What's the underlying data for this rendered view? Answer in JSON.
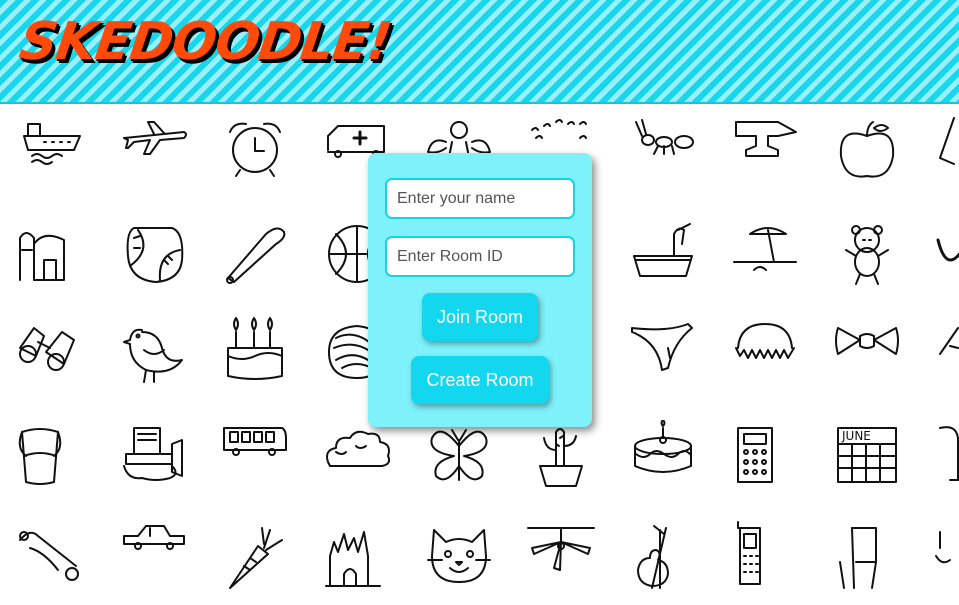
{
  "header": {
    "logo": "SKEDOODLE!",
    "colors": {
      "stripe_dark": "#19d6ea",
      "stripe_light": "#9af0fa",
      "logo": "#ff4a0a"
    }
  },
  "background_doodles": {
    "rows": [
      [
        "boat-icon",
        "airplane-icon",
        "alarm-clock-icon",
        "ambulance-icon",
        "angel-icon",
        "animal-migration-icon",
        "ant-icon",
        "anvil-icon",
        "apple-icon",
        "arm-icon"
      ],
      [
        "barn-icon",
        "baseball-icon",
        "baseball-bat-icon",
        "basketball-icon",
        "bat-icon",
        "bathtub-icon",
        "beach-icon",
        "bear-icon",
        "beard-icon"
      ],
      [
        "binoculars-icon",
        "bird-icon",
        "birthday-cake-icon",
        "blackberry-icon",
        "blueberry-icon",
        "book-icon",
        "boomerang-icon",
        "bottlecap-icon",
        "bowtie-icon",
        "bracelet-icon"
      ],
      [
        "bucket-icon",
        "bulldozer-icon",
        "bus-icon",
        "bush-icon",
        "butterfly-icon",
        "cactus-icon",
        "cake-icon",
        "calculator-icon",
        "calendar-icon",
        "camel-icon"
      ],
      [
        "canoe-icon",
        "car-icon",
        "carrot-icon",
        "castle-icon",
        "cat-icon",
        "ceiling-fan-icon",
        "cello-icon",
        "cell-phone-icon",
        "chair-icon",
        "chandelier-icon"
      ]
    ],
    "calendar_text": "JUNE"
  },
  "room_panel": {
    "name_placeholder": "Enter your name",
    "room_placeholder": "Enter Room ID",
    "join_label": "Join Room",
    "create_label": "Create Room",
    "colors": {
      "panel": "#7ef1fb",
      "button": "#13d7ee"
    }
  }
}
